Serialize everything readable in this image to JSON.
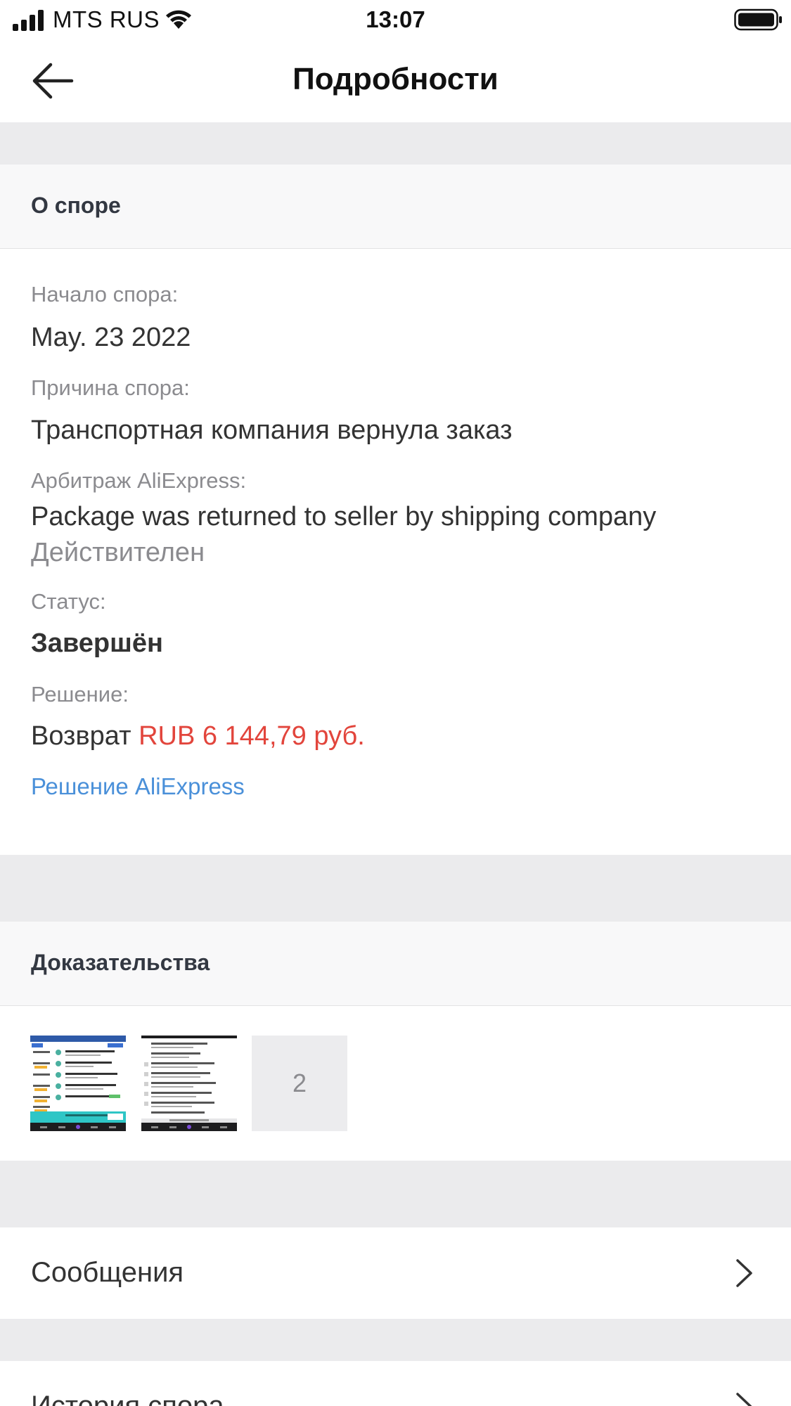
{
  "status_bar": {
    "carrier": "MTS RUS",
    "time": "13:07",
    "signal_icon": "cellular-signal-icon",
    "wifi_icon": "wifi-icon",
    "battery_icon": "battery-icon"
  },
  "nav": {
    "title": "Подробности",
    "back_icon": "back-arrow-icon"
  },
  "dispute": {
    "section_title": "О споре",
    "start_label": "Начало спора:",
    "start_value": "May. 23 2022",
    "reason_label": "Причина спора:",
    "reason_value": "Транспортная компания вернула заказ",
    "arbitration_label": "Арбитраж AliExpress:",
    "arbitration_value": "Package was returned to seller by shipping company",
    "arbitration_validity": "Действителен",
    "status_label": "Статус:",
    "status_value": "Завершён",
    "resolution_label": "Решение:",
    "resolution_prefix": "Возврат",
    "resolution_amount": "RUB 6 144,79 руб.",
    "resolution_link": "Решение AliExpress"
  },
  "evidence": {
    "section_title": "Доказательства",
    "more_count": "2"
  },
  "rows": {
    "messages_label": "Сообщения",
    "history_label": "История спора",
    "chevron_icon": "chevron-right-icon"
  },
  "colors": {
    "accent_link": "#4a90d9",
    "amount_red": "#e2453c",
    "separator_gray": "#ebebed"
  }
}
